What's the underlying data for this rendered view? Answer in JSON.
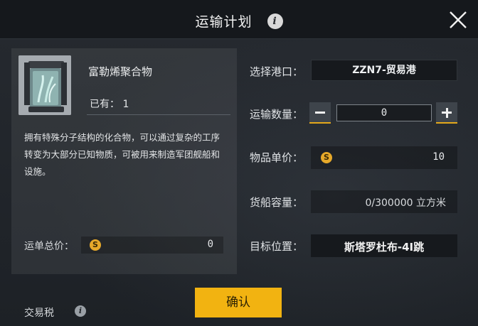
{
  "header": {
    "title": "运输计划",
    "info_icon": "i",
    "close_icon": "close-icon"
  },
  "item": {
    "name": "富勒烯聚合物",
    "owned_label": "已有：",
    "owned_value": "1",
    "description": "拥有特殊分子结构的化合物，可以通过复杂的工序转变为大部分已知物质，可被用来制造军团舰船和设施。"
  },
  "summary": {
    "total_label": "运单总价：",
    "total_value": "0",
    "tax_label": "交易税",
    "currency_icon": "S",
    "currency_color": "#e7a92a"
  },
  "form": {
    "port_label": "选择港口：",
    "port_value": "ZZN7-贸易港",
    "quantity_label": "运输数量：",
    "quantity_value": "0",
    "unit_price_label": "物品单价：",
    "unit_price_value": "10",
    "capacity_label": "货船容量：",
    "capacity_value": "0/300000 立方米",
    "target_label": "目标位置：",
    "target_value": "斯塔罗杜布-4I跳"
  },
  "actions": {
    "confirm_label": "确认",
    "confirm_color": "#f2b311"
  }
}
